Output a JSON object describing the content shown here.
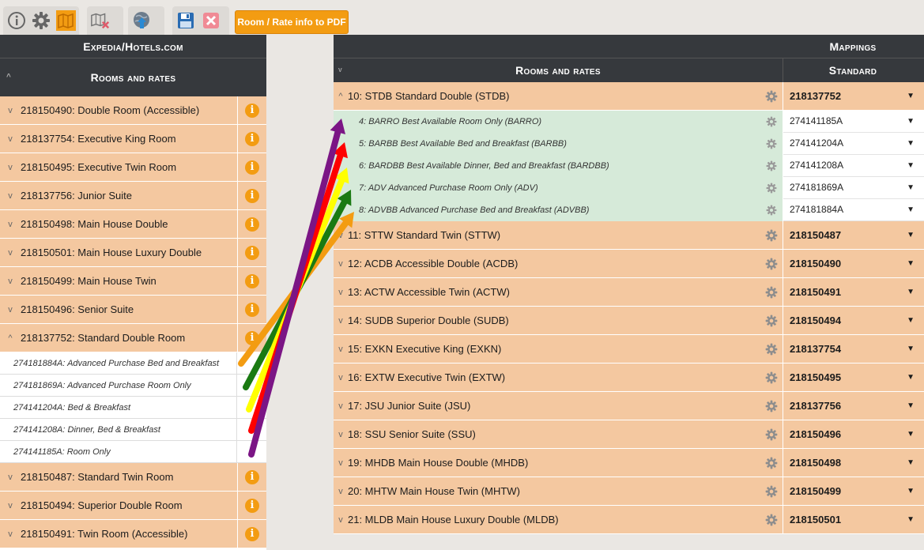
{
  "toolbar": {
    "icons": [
      "info-icon",
      "gear-icon",
      "map-icon",
      "unmap-icon",
      "globe-upload-icon",
      "save-icon",
      "close-icon"
    ],
    "pdf_button": "Room / Rate info to PDF"
  },
  "left": {
    "title": "Expedia/Hotels.com",
    "subtitle": "Rooms and rates",
    "rows_top": [
      "218150490: Double Room (Accessible)",
      "218137754: Executive King Room",
      "218150495: Executive Twin Room",
      "218137756: Junior Suite",
      "218150498: Main House Double",
      "218150501: Main House Luxury Double",
      "218150499: Main House Twin",
      "218150496: Senior Suite"
    ],
    "expanded_row": "218137752: Standard Double Room",
    "sub_rows": [
      "274181884A: Advanced Purchase Bed and Breakfast",
      "274181869A: Advanced Purchase Room Only",
      "274141204A: Bed & Breakfast",
      "274141208A: Dinner, Bed & Breakfast",
      "274141185A: Room Only"
    ],
    "rows_bottom": [
      "218150487: Standard Twin Room",
      "218150494: Superior Double Room",
      "218150491: Twin Room (Accessible)"
    ],
    "info_glyph": "i"
  },
  "right": {
    "title": "Mappings",
    "col1": "Rooms and rates",
    "col2": "Standard",
    "expanded": {
      "name": "10: STDB Standard Double (STDB)",
      "value": "218137752"
    },
    "sub_rows": [
      {
        "name": "4: BARRO Best Available Room Only (BARRO)",
        "value": "274141185A"
      },
      {
        "name": "5: BARBB Best Available Bed and Breakfast (BARBB)",
        "value": "274141204A"
      },
      {
        "name": "6: BARDBB Best Available Dinner, Bed and Breakfast (BARDBB)",
        "value": "274141208A"
      },
      {
        "name": "7: ADV Advanced Purchase Room Only (ADV)",
        "value": "274181869A"
      },
      {
        "name": "8: ADVBB Advanced Purchase Bed and Breakfast (ADVBB)",
        "value": "274181884A"
      }
    ],
    "rows": [
      {
        "name": "11: STTW Standard Twin (STTW)",
        "value": "218150487"
      },
      {
        "name": "12: ACDB Accessible Double (ACDB)",
        "value": "218150490"
      },
      {
        "name": "13: ACTW Accessible Twin (ACTW)",
        "value": "218150491"
      },
      {
        "name": "14: SUDB Superior Double (SUDB)",
        "value": "218150494"
      },
      {
        "name": "15: EXKN Executive King (EXKN)",
        "value": "218137754"
      },
      {
        "name": "16: EXTW Executive Twin (EXTW)",
        "value": "218150495"
      },
      {
        "name": "17: JSU Junior Suite (JSU)",
        "value": "218137756"
      },
      {
        "name": "18: SSU Senior Suite (SSU)",
        "value": "218150496"
      },
      {
        "name": "19: MHDB Main House Double (MHDB)",
        "value": "218150498"
      },
      {
        "name": "20: MHTW Main House Twin (MHTW)",
        "value": "218150499"
      },
      {
        "name": "21: MLDB Main House Luxury Double (MLDB)",
        "value": "218150501"
      }
    ]
  },
  "arrow_colors": [
    "#f39c12",
    "#1a7a12",
    "#ffff00",
    "#ff0000",
    "#7b1585"
  ],
  "colors": {
    "accent": "#f39c12",
    "row_bg": "#f4c8a0",
    "mapped_bg": "#d6ead9",
    "header_bg": "#36393d"
  }
}
